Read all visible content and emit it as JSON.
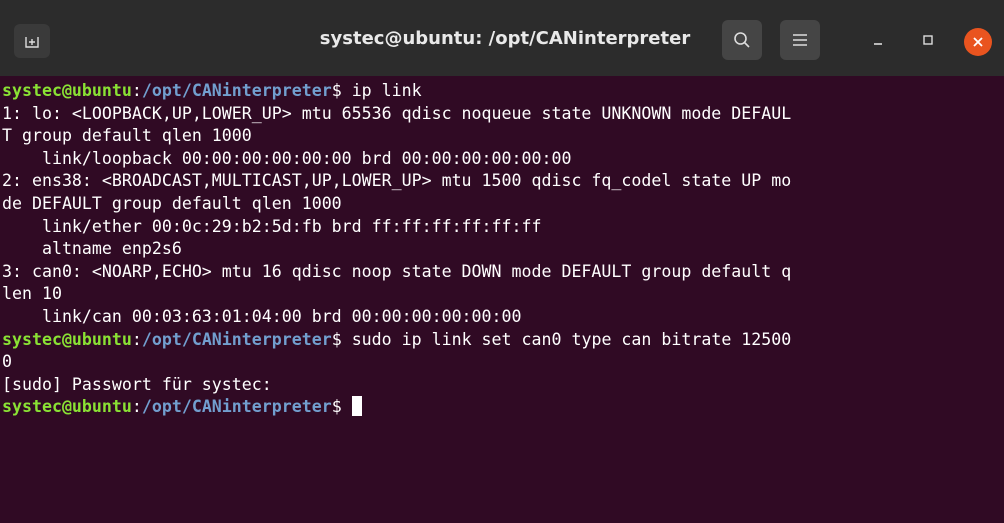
{
  "window": {
    "title": "systec@ubuntu: /opt/CANinterpreter",
    "bg_color": "#300a24",
    "titlebar_color": "#2c2c2c",
    "icons": {
      "new_tab": "new-tab-icon",
      "search": "search-icon",
      "menu": "hamburger-menu-icon",
      "minimize": "minimize-icon",
      "maximize": "maximize-icon",
      "close": "close-icon"
    }
  },
  "prompt": {
    "user_host": "systec@ubuntu",
    "separator": ":",
    "path": "/opt/CANinterpreter",
    "symbol": "$ "
  },
  "terminal": {
    "lines": [
      {
        "type": "prompt",
        "command": "ip link"
      },
      {
        "type": "output",
        "text": "1: lo: <LOOPBACK,UP,LOWER_UP> mtu 65536 qdisc noqueue state UNKNOWN mode DEFAUL"
      },
      {
        "type": "output",
        "text": "T group default qlen 1000"
      },
      {
        "type": "output",
        "text": "    link/loopback 00:00:00:00:00:00 brd 00:00:00:00:00:00"
      },
      {
        "type": "output",
        "text": "2: ens38: <BROADCAST,MULTICAST,UP,LOWER_UP> mtu 1500 qdisc fq_codel state UP mo"
      },
      {
        "type": "output",
        "text": "de DEFAULT group default qlen 1000"
      },
      {
        "type": "output",
        "text": "    link/ether 00:0c:29:b2:5d:fb brd ff:ff:ff:ff:ff:ff"
      },
      {
        "type": "output",
        "text": "    altname enp2s6"
      },
      {
        "type": "output",
        "text": "3: can0: <NOARP,ECHO> mtu 16 qdisc noop state DOWN mode DEFAULT group default q"
      },
      {
        "type": "output",
        "text": "len 10"
      },
      {
        "type": "output",
        "text": "    link/can 00:03:63:01:04:00 brd 00:00:00:00:00:00"
      },
      {
        "type": "prompt",
        "command": "sudo ip link set can0 type can bitrate 12500"
      },
      {
        "type": "output",
        "text": "0"
      },
      {
        "type": "output",
        "text": "[sudo] Passwort für systec:"
      },
      {
        "type": "prompt",
        "command": "",
        "cursor": true
      }
    ]
  }
}
